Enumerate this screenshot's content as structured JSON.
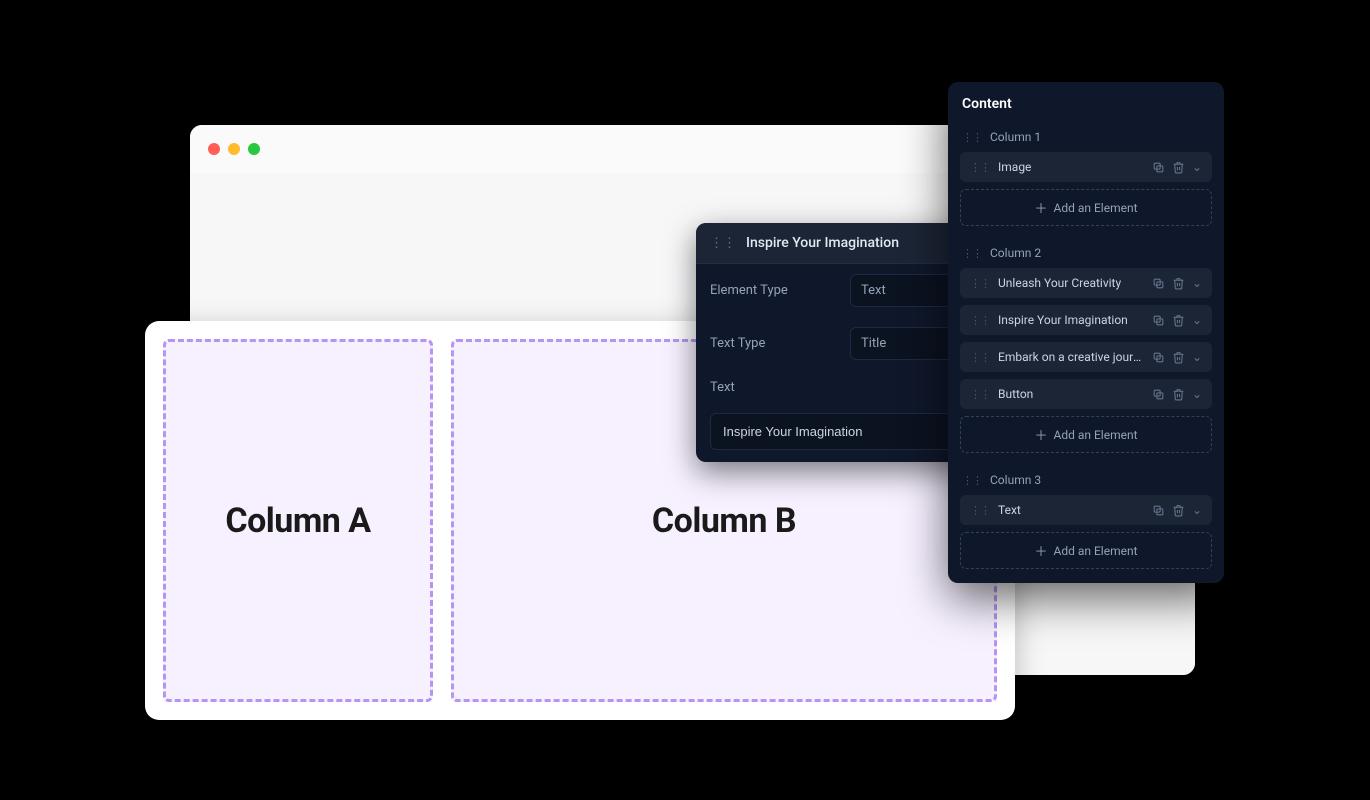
{
  "columns_card": {
    "a_label": "Column A",
    "b_label": "Column B"
  },
  "editor": {
    "title": "Inspire Your Imagination",
    "element_type_label": "Element Type",
    "element_type_value": "Text",
    "text_type_label": "Text Type",
    "text_type_value": "Title",
    "text_label": "Text",
    "text_value": "Inspire Your Imagination"
  },
  "content": {
    "panel_title": "Content",
    "add_element_label": "Add an Element",
    "columns": [
      {
        "header": "Column 1",
        "items": [
          {
            "label": "Image"
          }
        ]
      },
      {
        "header": "Column 2",
        "items": [
          {
            "label": "Unleash Your Creativity"
          },
          {
            "label": "Inspire Your Imagination"
          },
          {
            "label": "Embark on a creative journey li..."
          },
          {
            "label": "Button"
          }
        ]
      },
      {
        "header": "Column 3",
        "items": [
          {
            "label": "Text"
          }
        ]
      }
    ]
  }
}
